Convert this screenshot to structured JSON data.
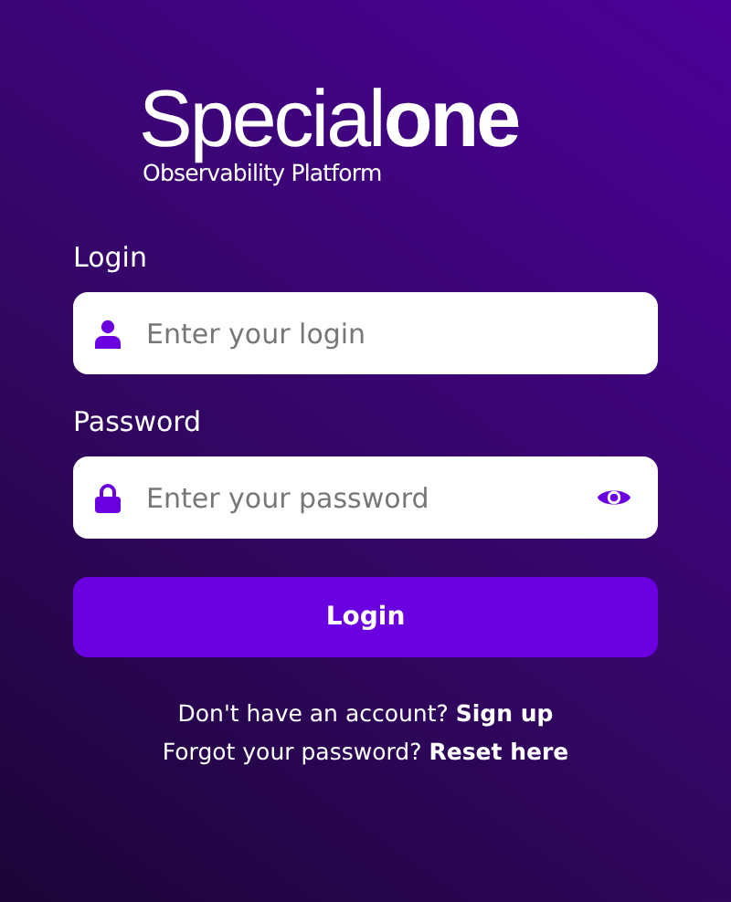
{
  "logo": {
    "light": "Special",
    "bold": "one",
    "tagline": "Observability Platform"
  },
  "fields": [
    {
      "label": "Login",
      "placeholder": "Enter your login",
      "kind": "user"
    },
    {
      "label": "Password",
      "placeholder": "Enter your password",
      "kind": "lock"
    }
  ],
  "submit": "Login",
  "links": [
    {
      "text": "Don't have an account?",
      "link": "Sign up"
    },
    {
      "text": "Forgot your password?",
      "link": "Reset here"
    }
  ]
}
